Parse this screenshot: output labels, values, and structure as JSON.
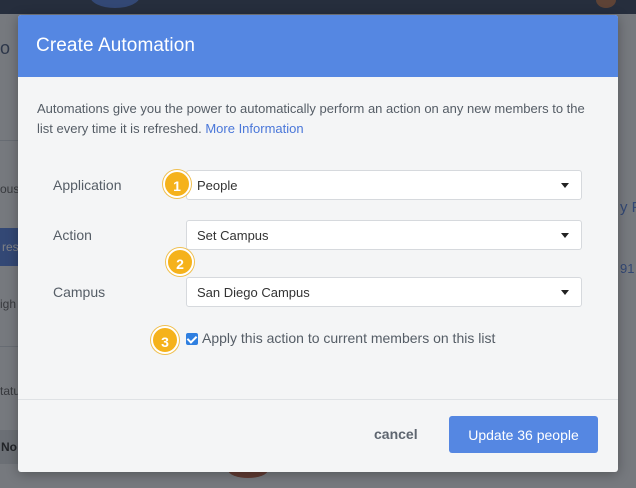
{
  "background": {
    "fragments": {
      "heading_fragment": "o",
      "sidebar_1": "ous",
      "tab_text": "res",
      "sidebar_2": "igh",
      "sidebar_3": "tatu",
      "footer_cell": "No",
      "right_1": "y P",
      "right_2": "91"
    }
  },
  "modal": {
    "title": "Create Automation",
    "intro_text": "Automations give you the power to automatically perform an action on any new members to the list every time it is refreshed.",
    "intro_link": "More Information",
    "fields": {
      "application": {
        "label": "Application",
        "value": "People"
      },
      "action": {
        "label": "Action",
        "value": "Set Campus"
      },
      "campus": {
        "label": "Campus",
        "value": "San Diego Campus"
      }
    },
    "checkbox": {
      "label": "Apply this action to current members on this list",
      "checked": true
    },
    "badges": [
      "1",
      "2",
      "3"
    ],
    "footer": {
      "cancel_label": "cancel",
      "submit_label": "Update 36 people"
    }
  },
  "colors": {
    "header_blue": "#5587e2",
    "badge_yellow": "#f5b21b",
    "link_blue": "#4a77d9"
  }
}
